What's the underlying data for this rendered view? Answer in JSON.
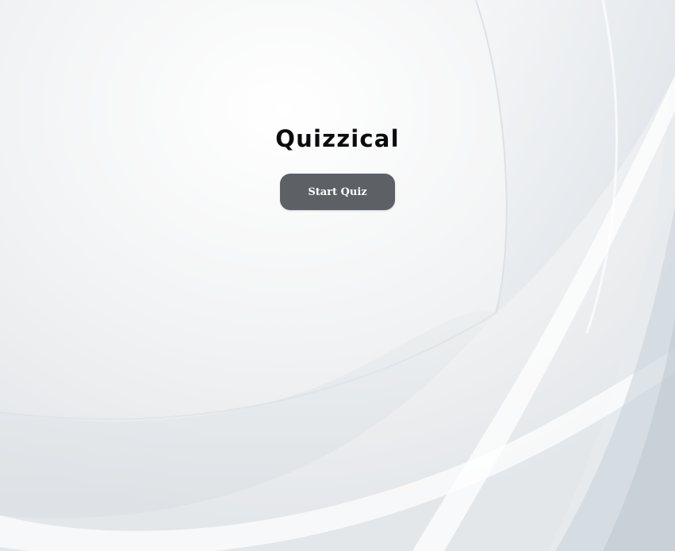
{
  "app": {
    "title": "Quizzical"
  },
  "start_screen": {
    "start_button_label": "Start Quiz"
  },
  "colors": {
    "background": "#f3f4f5",
    "button_background": "#5d6166",
    "button_text": "#ffffff",
    "title_text": "#0b0b0d"
  }
}
